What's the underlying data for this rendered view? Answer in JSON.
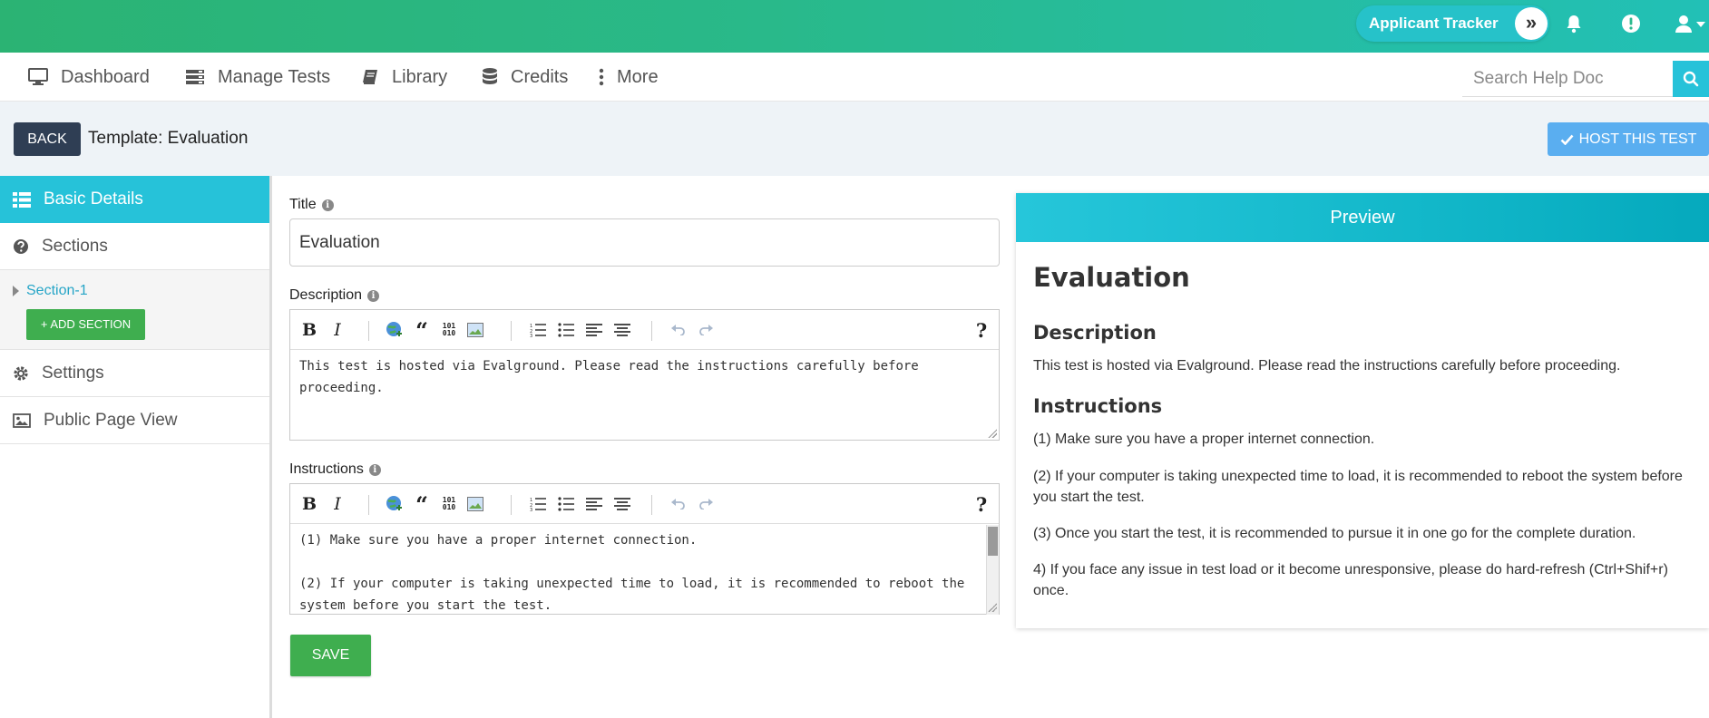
{
  "topbar": {
    "applicant_tracker_label": "Applicant Tracker",
    "expand_glyph": "»",
    "icons": [
      "bell-icon",
      "alert-icon",
      "user-icon",
      "caret-down-icon"
    ]
  },
  "nav": {
    "items": [
      {
        "label": "Dashboard",
        "icon": "monitor-icon"
      },
      {
        "label": "Manage Tests",
        "icon": "server-icon"
      },
      {
        "label": "Library",
        "icon": "book-icon"
      },
      {
        "label": "Credits",
        "icon": "database-icon"
      },
      {
        "label": "More",
        "icon": "dots-vertical-icon"
      }
    ],
    "search_placeholder": "Search Help Doc"
  },
  "header": {
    "back_label": "BACK",
    "template_title": "Template: Evaluation",
    "host_label": "HOST THIS TEST"
  },
  "sidebar": {
    "items": [
      {
        "label": "Basic Details",
        "icon": "list-icon"
      },
      {
        "label": "Sections",
        "icon": "question-circle-icon"
      },
      {
        "label": "Settings",
        "icon": "gear-icon"
      },
      {
        "label": "Public Page View",
        "icon": "image-icon"
      }
    ],
    "section_link": "Section-1",
    "add_section_label": "+ ADD SECTION"
  },
  "form": {
    "title_label": "Title",
    "title_value": "Evaluation",
    "description_label": "Description",
    "description_text": "This test is hosted via Evalground. Please read the instructions carefully before proceeding.",
    "instructions_label": "Instructions",
    "instructions_text": "(1) Make sure you have a proper internet connection.\n\n(2) If your computer is taking unexpected time to load, it is recommended to reboot the system before you start the test.",
    "save_label": "SAVE",
    "toolbar": {
      "bold": "B",
      "italic": "I",
      "quote": "“",
      "code": "101 010",
      "help": "?"
    }
  },
  "preview": {
    "header": "Preview",
    "title": "Evaluation",
    "description_heading": "Description",
    "description_text": "This test is hosted via Evalground. Please read the instructions carefully before proceeding.",
    "instructions_heading": "Instructions",
    "instructions": [
      "(1) Make sure you have a proper internet connection.",
      "(2) If your computer is taking unexpected time to load, it is recommended to reboot the system before you start the test.",
      "(3) Once you start the test, it is recommended to pursue it in one go for the complete duration.",
      "4) If you face any issue in test load or it become unresponsive, please do hard-refresh (Ctrl+Shif+r) once."
    ]
  },
  "colors": {
    "accent": "#26c2d9",
    "success": "#3fae4f",
    "dark_button": "#2f3e54",
    "host_button": "#5aaef0"
  }
}
